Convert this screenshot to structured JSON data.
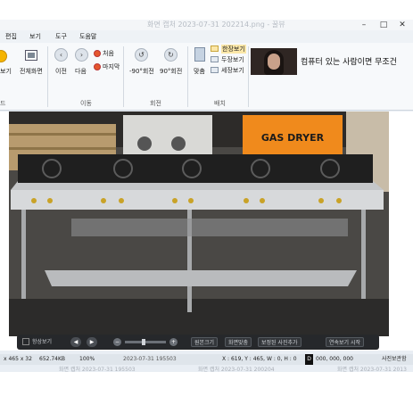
{
  "window": {
    "title": "화면 캡처 2023-07-31 202214.png - 꿀뷰",
    "minimize": "–",
    "maximize": "□",
    "close": "✕"
  },
  "menu": [
    "편집",
    "보기",
    "도구",
    "도움말"
  ],
  "ribbon": {
    "open_label": "보기",
    "fullscreen_label": "전체화면",
    "prev_label": "이전",
    "next_label": "다음",
    "first_label": "처음",
    "last_label": "마지막",
    "rotate_left_label": "-90°회전",
    "rotate_right_label": "90°회전",
    "fit_label": "맞춤",
    "single_view_label": "한장보기",
    "double_view_label": "두장보기",
    "three_view_label": "세장보기",
    "group_move": "이동",
    "group_rotate": "회전",
    "group_layout": "배치",
    "group_left_cut": "드"
  },
  "ad": {
    "text": "컴퓨터 있는 사람이면 무조건"
  },
  "image": {
    "sign_text": "GAS DRYER"
  },
  "viewer_toolbar": {
    "always_on_top": "항상보기",
    "original_size": "원본크기",
    "fit_screen": "화면맞춤",
    "save_corrected": "보정된 사진추가",
    "slideshow": "연속보기 시작"
  },
  "status": {
    "dimensions": "x 465 x 32",
    "filesize": "652.74KB",
    "zoom": "100%",
    "date": "2023-07-31 195503",
    "coords": "X : 619, Y : 465, W : 0, H : 0",
    "pixel_label": "D",
    "pixel_value": "000, 000, 000",
    "right_text": "사진보관함"
  },
  "thumbnails": [
    "화면 캡처 2023-07-31 195503",
    "화면 캡처 2023-07-31 200204",
    "화면 캡처 2023-07-31 2013"
  ],
  "colors": {
    "accent": "#1e6fd0",
    "toolbar_bg": "#26282b",
    "sign_bg": "#f08a1c"
  }
}
